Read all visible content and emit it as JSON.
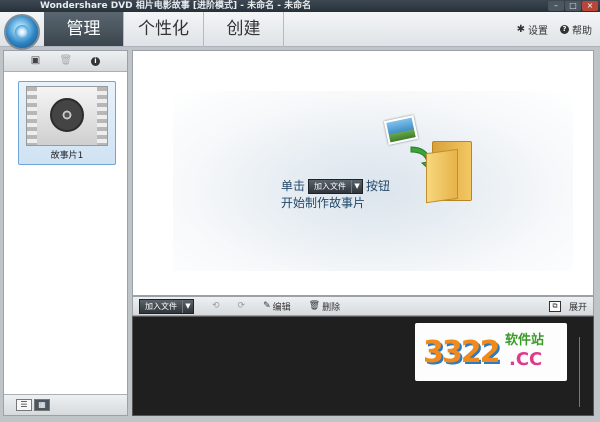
{
  "window": {
    "title": "Wondershare DVD 相片电影故事 [进阶模式] - 未命名 - 未命名"
  },
  "nav": {
    "tabs": [
      {
        "label": "管理"
      },
      {
        "label": "个性化"
      },
      {
        "label": "创建"
      }
    ],
    "settings_label": "设置",
    "help_label": "帮助"
  },
  "sidebar": {
    "items": [
      {
        "label": "故事片1"
      }
    ]
  },
  "main": {
    "hint_prefix": "单击",
    "hint_button": "加入文件",
    "hint_suffix": "按钮",
    "hint_line2": "开始制作故事片"
  },
  "bottombar": {
    "add_label": "加入文件",
    "edit_label": "编辑",
    "delete_label": "删除",
    "expand_label": "展开"
  },
  "watermark": {
    "digits": "3322",
    "text1": "软件站",
    "text2": ".CC"
  }
}
